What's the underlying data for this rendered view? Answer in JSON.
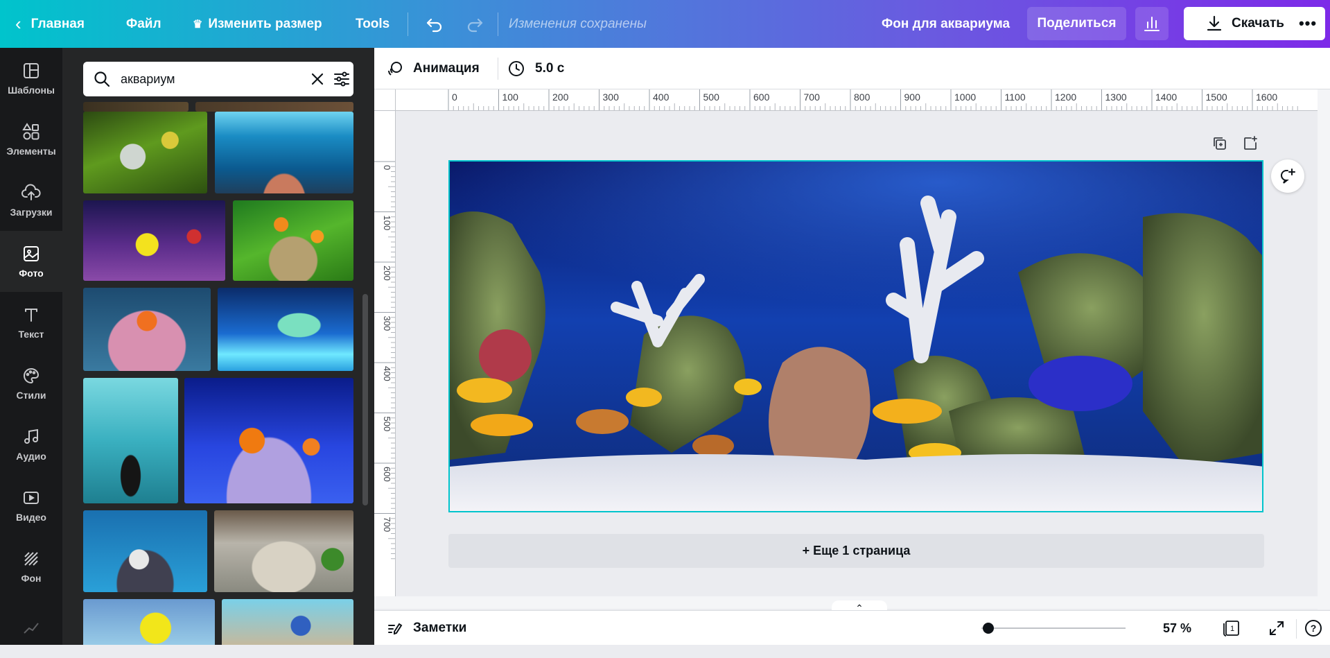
{
  "header": {
    "home_label": "Главная",
    "file_label": "Файл",
    "resize_label": "Изменить размер",
    "tools_label": "Tools",
    "saved_status": "Изменения сохранены",
    "design_title": "Фон для аквариума",
    "share_label": "Поделиться",
    "download_label": "Скачать",
    "more_label": "•••"
  },
  "rail": {
    "items": [
      {
        "label": "Шаблоны",
        "icon": "templates-icon"
      },
      {
        "label": "Элементы",
        "icon": "elements-icon"
      },
      {
        "label": "Загрузки",
        "icon": "upload-icon"
      },
      {
        "label": "Фото",
        "icon": "photo-icon",
        "active": true
      },
      {
        "label": "Текст",
        "icon": "text-icon"
      },
      {
        "label": "Стили",
        "icon": "styles-icon"
      },
      {
        "label": "Аудио",
        "icon": "audio-icon"
      },
      {
        "label": "Видео",
        "icon": "video-icon"
      },
      {
        "label": "Фон",
        "icon": "background-icon"
      }
    ]
  },
  "search": {
    "query": "аквариум"
  },
  "subbar": {
    "animation_label": "Анимация",
    "duration": "5.0 с"
  },
  "ruler": {
    "h_ticks": [
      "0",
      "100",
      "200",
      "300",
      "400",
      "500",
      "600",
      "700",
      "800",
      "900",
      "1000",
      "1100",
      "1200",
      "1300",
      "1400",
      "1500",
      "1600"
    ],
    "v_ticks": [
      "0",
      "100",
      "200",
      "300",
      "400",
      "500",
      "600",
      "700"
    ]
  },
  "canvas": {
    "add_page_label": "+ Еще 1 страница"
  },
  "footer": {
    "notes_label": "Заметки",
    "zoom_value": "57 %",
    "zoom_fraction": 0.05,
    "page_count": "1",
    "help_label": "?"
  },
  "colors": {
    "accent": "#00c4cc",
    "brand_purple": "#7d2ae8"
  }
}
